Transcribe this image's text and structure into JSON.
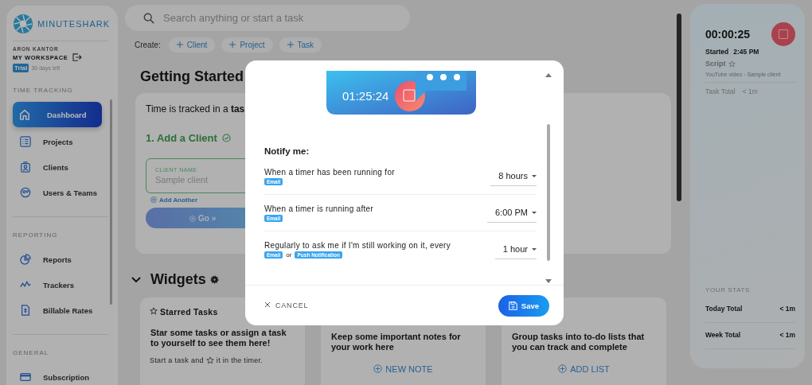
{
  "sidebar": {
    "logo": "MINUTESHARK",
    "user": "ARON KANTOR",
    "workspace": "MY WORKSPACE",
    "trial_badge": "Trial",
    "trial_note": "30 days left",
    "sections": [
      {
        "title": "TIME TRACKING",
        "items": [
          {
            "label": "Dashboard",
            "kind": "home",
            "selected": true
          },
          {
            "label": "Projects",
            "kind": "list",
            "selected": false
          },
          {
            "label": "Clients",
            "kind": "client",
            "selected": false
          },
          {
            "label": "Users & Teams",
            "kind": "users",
            "selected": false
          }
        ]
      },
      {
        "title": "REPORTING",
        "items": [
          {
            "label": "Reports",
            "kind": "pie",
            "selected": false
          },
          {
            "label": "Trackers",
            "kind": "wave",
            "selected": false
          },
          {
            "label": "Billable Rates",
            "kind": "doc",
            "selected": false
          }
        ]
      },
      {
        "title": "GENERAL",
        "items": [
          {
            "label": "Subscription",
            "kind": "card",
            "selected": false
          }
        ]
      }
    ]
  },
  "search": {
    "placeholder": "Search anything or start a task"
  },
  "create": {
    "label": "Create:",
    "buttons": [
      "Client",
      "Project",
      "Task"
    ]
  },
  "getting_started": {
    "title": "Getting Started",
    "intro": "Time is tracked in a **tas**",
    "step": "1. Add a Client",
    "step_done": true,
    "field_label": "CLIENT NAME",
    "field_placeholder": "Sample client",
    "add_another": "Add Another",
    "go": "Go »"
  },
  "widgets": {
    "title": "Widgets",
    "expanded": true,
    "cards": [
      {
        "title": "Starred Tasks",
        "body": "Star some tasks or assign a task to yourself to see them here!",
        "note_before": "Start a task and",
        "note_after": "it in the timer."
      },
      {
        "body": "Keep some important notes for your work here",
        "action": "NEW NOTE"
      },
      {
        "body": "Group tasks into to-do lists that you can track and complete",
        "action": "ADD LIST"
      }
    ]
  },
  "timer": {
    "elapsed": "00:00:25",
    "started_label": "Started",
    "started_time": "2:45 PM",
    "task": "Script",
    "starred": false,
    "subtitle": "YouTube video - Sample client",
    "task_total_label": "Task Total",
    "task_total": "< 1m",
    "stats_title": "YOUR STATS",
    "stats": [
      {
        "label": "Today Total",
        "value": "< 1m"
      },
      {
        "label": "Week Total",
        "value": "< 1m"
      }
    ]
  },
  "modal": {
    "illustration_time": "01:25:24",
    "heading": "Notify me:",
    "rules": [
      {
        "label": "When a timer has been running for",
        "channels": [
          {
            "kind": "tag",
            "text": "Email"
          }
        ],
        "value": "8 hours"
      },
      {
        "label": "When a timer is running after",
        "channels": [
          {
            "kind": "tag",
            "text": "Email"
          }
        ],
        "value": "6:00 PM"
      },
      {
        "label": "Regularly to ask me if I'm still working on it, every",
        "channels": [
          {
            "kind": "tag",
            "text": "Email"
          },
          {
            "kind": "text",
            "text": "or"
          },
          {
            "kind": "tag",
            "text": "Push Notification"
          }
        ],
        "value": "1 hour"
      }
    ],
    "cancel": "CANCEL",
    "save": "Save"
  }
}
